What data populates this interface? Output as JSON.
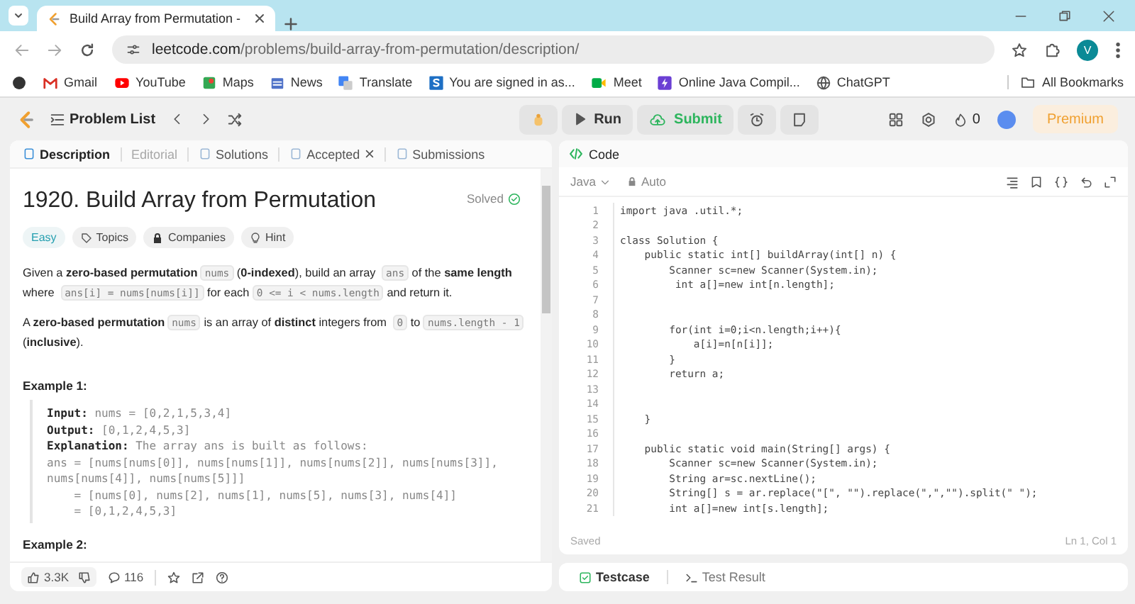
{
  "browser": {
    "tab_title": "Build Array from Permutation -",
    "url_host": "leetcode.com",
    "url_path": "/problems/build-array-from-permutation/description/",
    "profile_initial": "V",
    "bookmarks": [
      {
        "label": "Gmail"
      },
      {
        "label": "YouTube"
      },
      {
        "label": "Maps"
      },
      {
        "label": "News"
      },
      {
        "label": "Translate"
      },
      {
        "label": "You are signed in as..."
      },
      {
        "label": "Meet"
      },
      {
        "label": "Online Java Compil..."
      },
      {
        "label": "ChatGPT"
      }
    ],
    "all_bookmarks": "All Bookmarks"
  },
  "nav": {
    "problem_list": "Problem List",
    "run": "Run",
    "submit": "Submit",
    "streak": "0",
    "premium": "Premium"
  },
  "left_tabs": [
    {
      "label": "Description",
      "selected": true,
      "disabled": false,
      "closable": false
    },
    {
      "label": "Editorial",
      "selected": false,
      "disabled": true,
      "closable": false
    },
    {
      "label": "Solutions",
      "selected": false,
      "disabled": false,
      "closable": false
    },
    {
      "label": "Accepted",
      "selected": false,
      "disabled": false,
      "closable": true
    },
    {
      "label": "Submissions",
      "selected": false,
      "disabled": false,
      "closable": false
    }
  ],
  "problem": {
    "title": "1920. Build Array from Permutation",
    "status": "Solved",
    "difficulty": "Easy",
    "tags": [
      "Topics",
      "Companies",
      "Hint"
    ],
    "paragraphs": [
      [
        {
          "kind": "text",
          "text": "Given a "
        },
        {
          "kind": "bold",
          "text": "zero-based permutation"
        },
        {
          "kind": "code",
          "text": "nums"
        },
        {
          "kind": "text",
          "text": " ("
        },
        {
          "kind": "bold",
          "text": "0-indexed"
        },
        {
          "kind": "text",
          "text": "), build an array "
        },
        {
          "kind": "code",
          "text": "ans"
        },
        {
          "kind": "text",
          "text": " of the "
        },
        {
          "kind": "bold",
          "text": "same length"
        },
        {
          "kind": "text",
          "text": " where "
        },
        {
          "kind": "code",
          "text": "ans[i] = nums[nums[i]]"
        },
        {
          "kind": "text",
          "text": " for each "
        },
        {
          "kind": "code",
          "text": "0 <= i < nums.length"
        },
        {
          "kind": "text",
          "text": " and return it."
        }
      ],
      [
        {
          "kind": "text",
          "text": "A "
        },
        {
          "kind": "bold",
          "text": "zero-based permutation"
        },
        {
          "kind": "code",
          "text": "nums"
        },
        {
          "kind": "text",
          "text": " is an array of "
        },
        {
          "kind": "bold",
          "text": "distinct"
        },
        {
          "kind": "text",
          "text": " integers from "
        },
        {
          "kind": "code",
          "text": "0"
        },
        {
          "kind": "text",
          "text": " to "
        },
        {
          "kind": "code",
          "text": "nums.length - 1"
        },
        {
          "kind": "text",
          "text": " ("
        },
        {
          "kind": "bold",
          "text": "inclusive"
        },
        {
          "kind": "text",
          "text": ")."
        }
      ]
    ],
    "examples": [
      {
        "heading": "Example 1:",
        "lines": [
          "**Input:** nums = [0,2,1,5,3,4]",
          "**Output:** [0,1,2,4,5,3]",
          "**Explanation:** The array ans is built as follows:",
          "ans = [nums[nums[0]], nums[nums[1]], nums[nums[2]], nums[nums[3]], nums[nums[4]], nums[nums[5]]]",
          "    = [nums[0], nums[2], nums[1], nums[5], nums[3], nums[4]]",
          "    = [0,1,2,4,5,3]"
        ]
      },
      {
        "heading": "Example 2:"
      }
    ]
  },
  "footer": {
    "likes": "3.3K",
    "comments": "116"
  },
  "editor": {
    "title": "Code",
    "language": "Java",
    "mode": "Auto",
    "status": "Saved",
    "cursor": "Ln 1, Col 1",
    "lines": [
      {
        "number": "1",
        "text": "import java .util.*;"
      },
      {
        "number": "2"
      },
      {
        "number": "3",
        "text": "class Solution {"
      },
      {
        "number": "4",
        "text": "    public static int[] buildArray(int[] n) {"
      },
      {
        "number": "5",
        "text": "        Scanner sc=new Scanner(System.in);"
      },
      {
        "number": "6",
        "text": "         int a[]=new int[n.length];"
      },
      {
        "number": "7"
      },
      {
        "number": "8"
      },
      {
        "number": "9",
        "text": "        for(int i=0;i<n.length;i++){"
      },
      {
        "number": "10",
        "text": "            a[i]=n[n[i]];"
      },
      {
        "number": "11",
        "text": "        }"
      },
      {
        "number": "12",
        "text": "        return a;"
      },
      {
        "number": "13"
      },
      {
        "number": "14"
      },
      {
        "number": "15",
        "text": "    }"
      },
      {
        "number": "16"
      },
      {
        "number": "17",
        "text": "    public static void main(String[] args) {"
      },
      {
        "number": "18",
        "text": "        Scanner sc=new Scanner(System.in);"
      },
      {
        "number": "19",
        "text": "        String ar=sc.nextLine();"
      },
      {
        "number": "20",
        "text": "        String[] s = ar.replace(\"[\", \"\").replace(\",\",\"\").split(\" \");"
      },
      {
        "number": "21",
        "text": "        int a[]=new int[s.length];"
      }
    ]
  },
  "console_tabs": [
    {
      "label": "Testcase",
      "selected": true
    },
    {
      "label": "Test Result",
      "selected": false
    }
  ]
}
